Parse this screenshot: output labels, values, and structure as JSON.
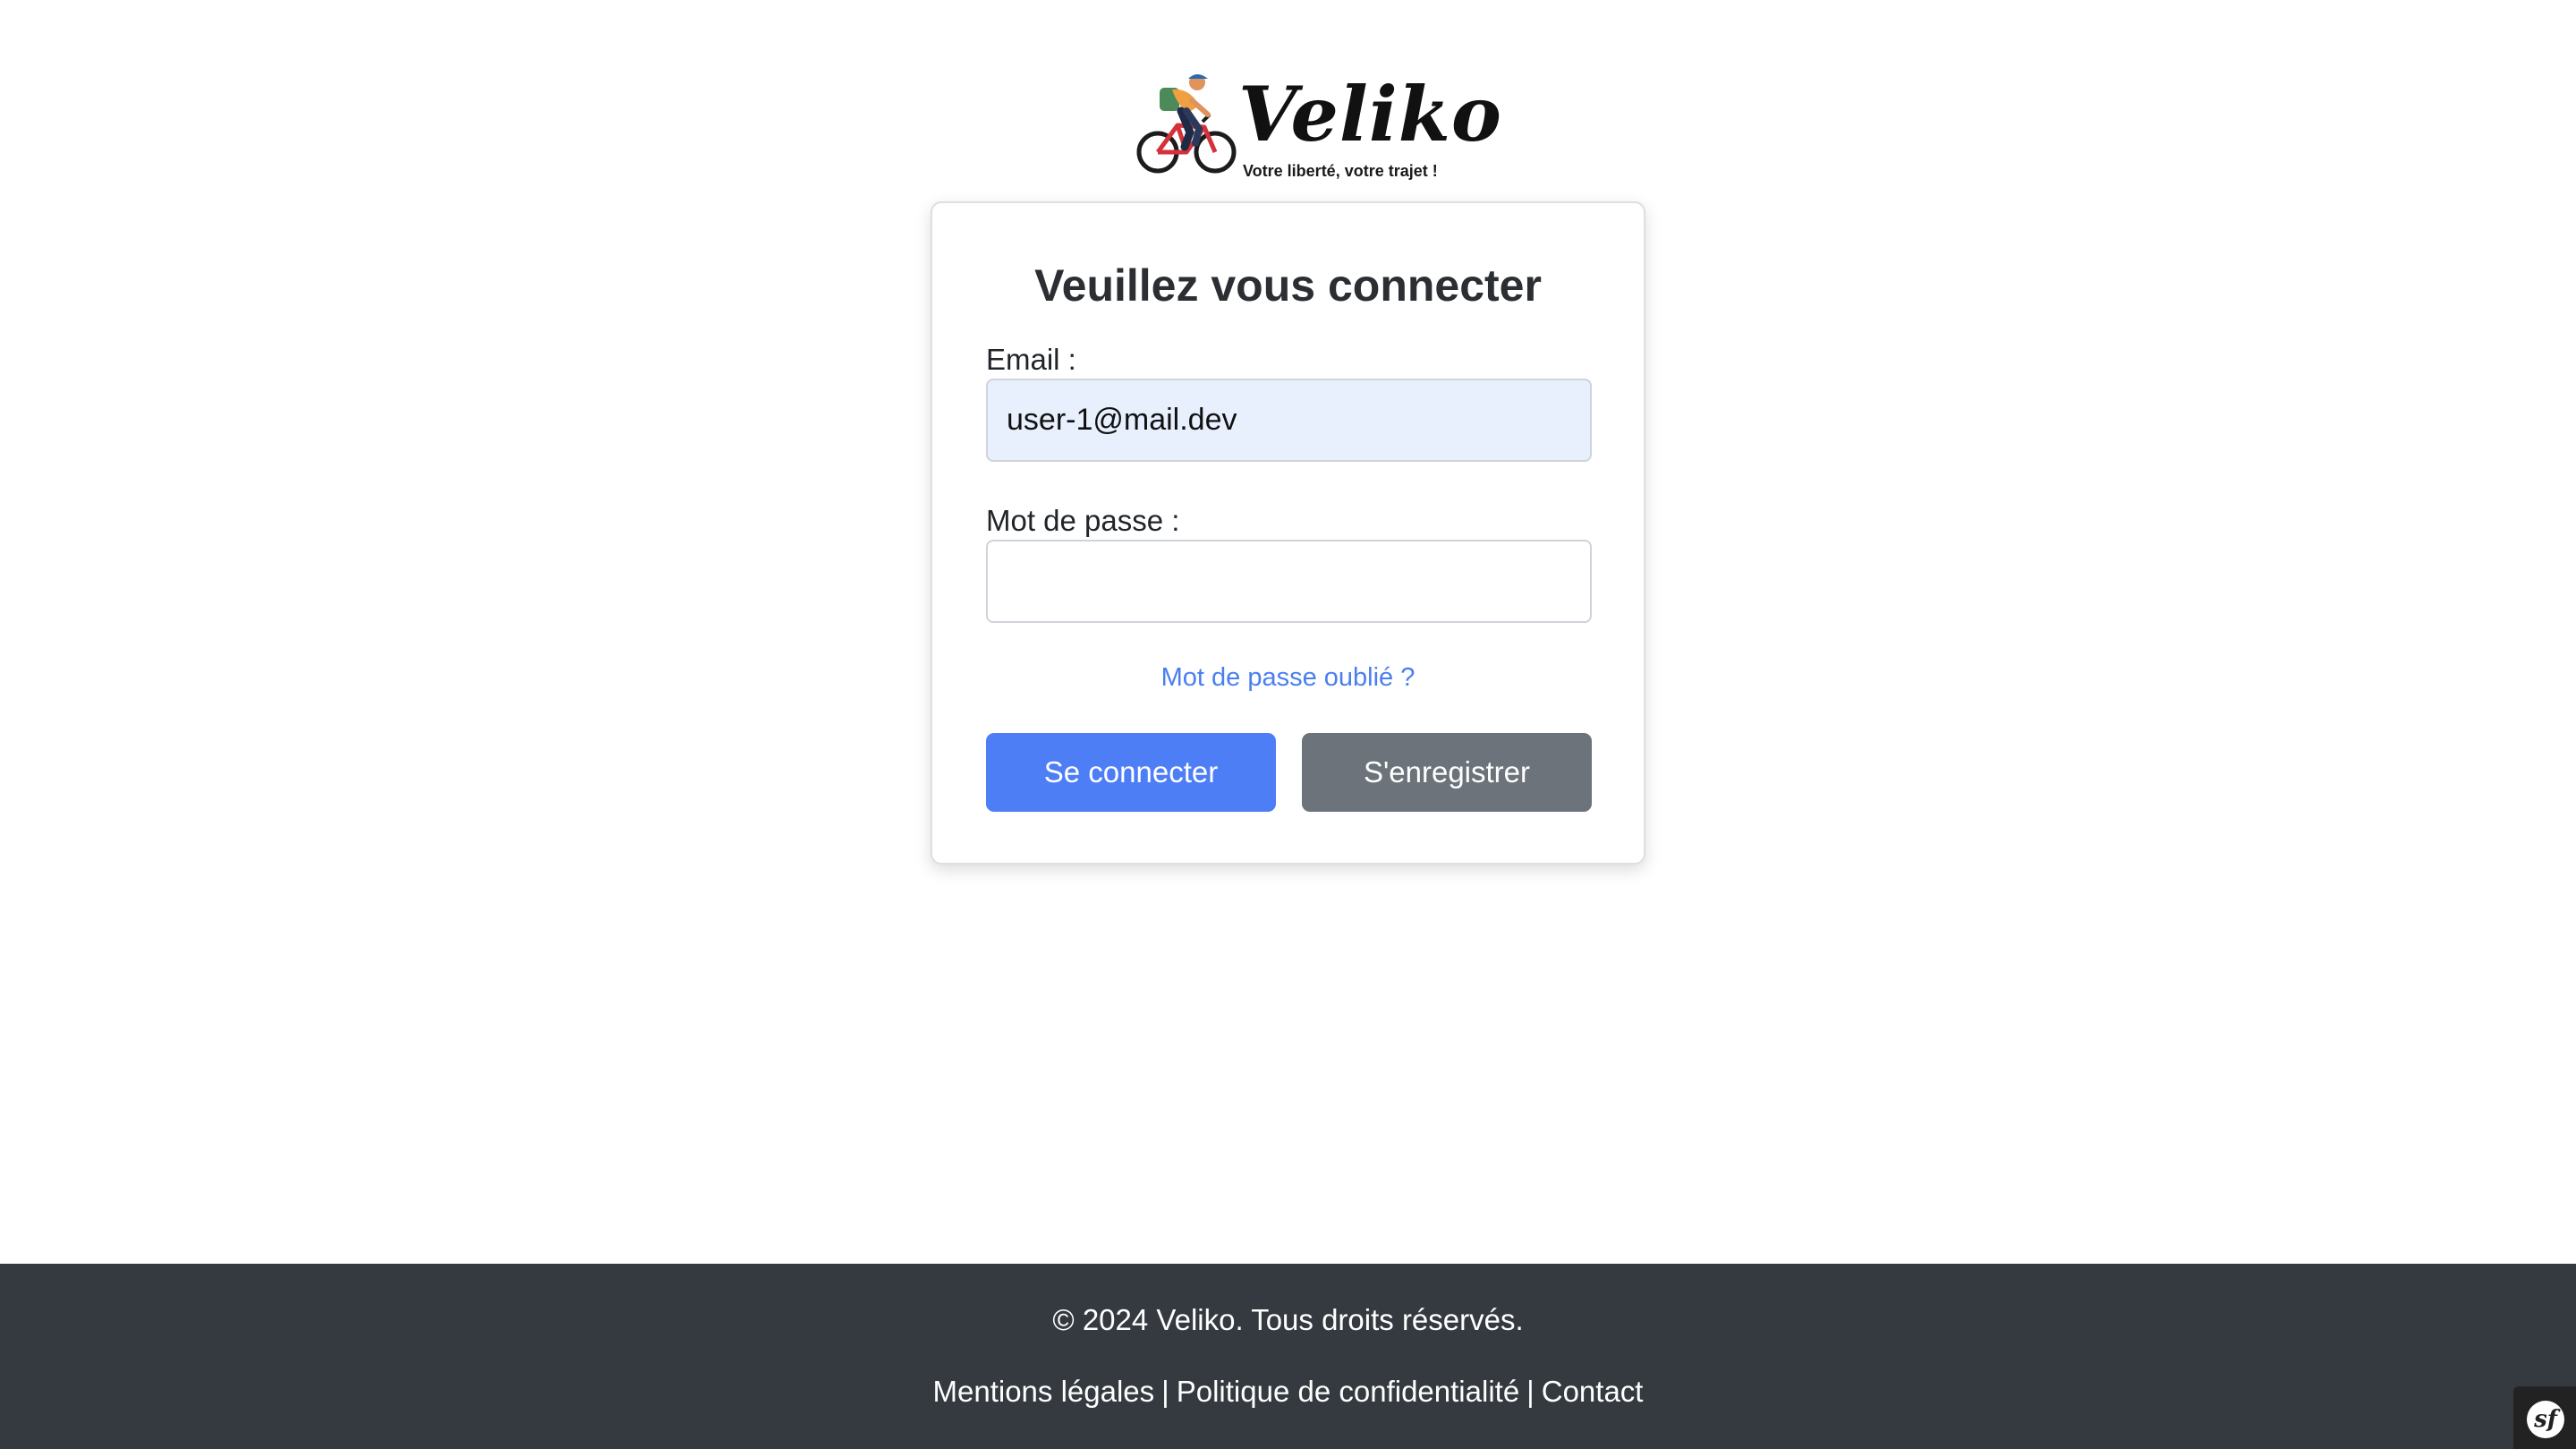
{
  "brand": {
    "name": "Veliko",
    "tagline": "Votre liberté, votre trajet !",
    "logo_icon": "cyclist-icon"
  },
  "login": {
    "title": "Veuillez vous connecter",
    "email_label": "Email :",
    "email_value": "user-1@mail.dev",
    "password_label": "Mot de passe :",
    "password_value": "",
    "forgot_link": "Mot de passe oublié ?",
    "login_button": "Se connecter",
    "register_button": "S'enregistrer"
  },
  "footer": {
    "copyright": "© 2024 Veliko. Tous droits réservés.",
    "links": [
      "Mentions légales",
      "Politique de confidentialité",
      "Contact"
    ],
    "separator": "|"
  },
  "debug_toolbar": {
    "icon": "symfony-icon",
    "glyph": "sf"
  },
  "colors": {
    "primary": "#4d7ef6",
    "secondary": "#6c737a",
    "link": "#4a7ef0",
    "footer_bg": "#343a40",
    "autofill_bg": "#e8f0fe"
  }
}
